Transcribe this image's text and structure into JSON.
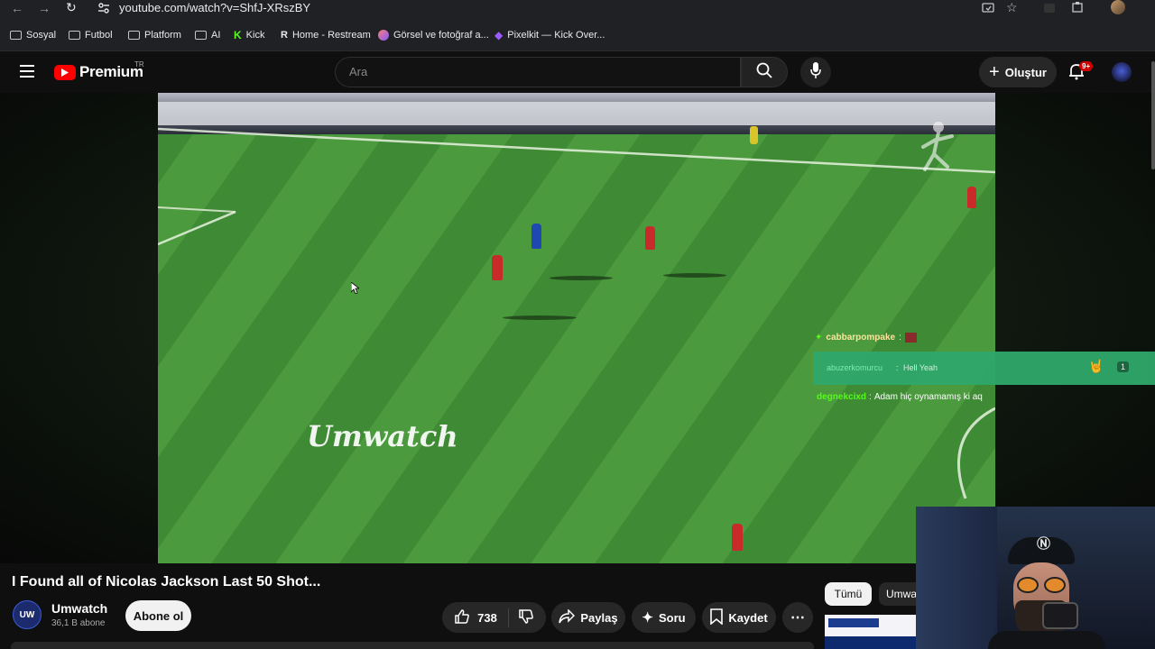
{
  "browser": {
    "url": "youtube.com/watch?v=ShfJ-XRszBY",
    "bookmarks": [
      {
        "label": "Sosyal",
        "icon": "folder-icon"
      },
      {
        "label": "Futbol",
        "icon": "folder-icon"
      },
      {
        "label": "Platform",
        "icon": "folder-icon"
      },
      {
        "label": "AI",
        "icon": "folder-icon"
      },
      {
        "label": "Kick",
        "icon": "kick-icon"
      },
      {
        "label": "Home - Restream",
        "icon": "restream-icon"
      },
      {
        "label": "Görsel ve fotoğraf a...",
        "icon": "image-icon"
      },
      {
        "label": "Pixelkit — Kick Over...",
        "icon": "pixelkit-icon"
      }
    ]
  },
  "header": {
    "logo_text": "Premium",
    "region": "TR",
    "search_placeholder": "Ara",
    "create_label": "Oluştur",
    "notifications_badge": "9+"
  },
  "video": {
    "watermark": "Umwatch",
    "title": "I Found all of Nicolas Jackson Last 50 Shot...",
    "overlay_chat": [
      {
        "user": "cabbarpompake",
        "sep": ":",
        "text": ""
      },
      {
        "user": "abuzerkomurcu",
        "sep": ":",
        "text": "Hell Yeah",
        "count": "1"
      },
      {
        "user": "degnekcixd",
        "sep": ":",
        "text": "Adam hiç oynamamış ki aq"
      }
    ]
  },
  "channel": {
    "name": "Umwatch",
    "subscribers": "36,1 B abone",
    "avatar_text": "UW",
    "subscribe_label": "Abone ol"
  },
  "actions": {
    "likes": "738",
    "share_label": "Paylaş",
    "ask_label": "Soru",
    "save_label": "Kaydet"
  },
  "chips": [
    "Tümü",
    "Umwa"
  ],
  "colors": {
    "youtube_red": "#ff0000",
    "pitch_green": "#4b9a3d",
    "chat_highlight": "#2fa86b"
  }
}
